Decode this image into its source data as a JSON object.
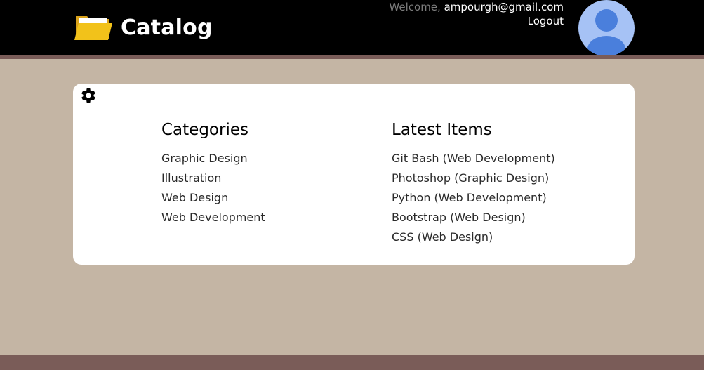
{
  "header": {
    "title": "Catalog",
    "welcome_label": "Welcome,",
    "user_email": "ampourgh@gmail.com",
    "logout_label": "Logout"
  },
  "categories": {
    "heading": "Categories",
    "items": [
      "Graphic Design",
      "Illustration",
      "Web Design",
      "Web Development"
    ]
  },
  "latest": {
    "heading": "Latest Items",
    "items": [
      "Git Bash (Web Development)",
      "Photoshop (Graphic Design)",
      "Python (Web Development)",
      "Bootstrap (Web Design)",
      "CSS (Web Design)"
    ]
  },
  "icons": {
    "brand": "folder-icon",
    "settings": "gear-icon",
    "avatar": "user-avatar-icon"
  },
  "colors": {
    "header_bg": "#000000",
    "page_bg": "#c4b5a4",
    "accent_bar": "#7a5c58",
    "card_bg": "#ffffff",
    "avatar_bg": "#a6c2f5",
    "avatar_figure": "#4a7fdc",
    "folder": "#f2c21a"
  }
}
